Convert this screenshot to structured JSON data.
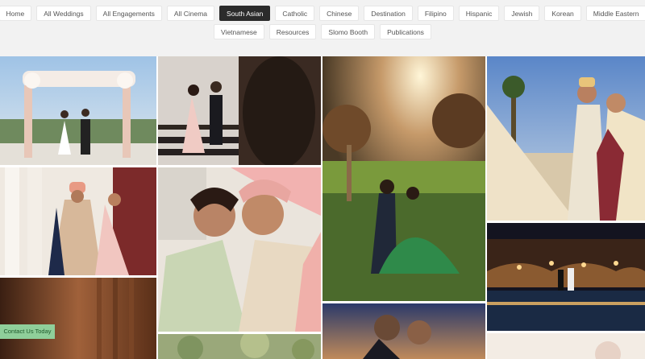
{
  "filters": {
    "row1": [
      {
        "label": "Home",
        "active": false
      },
      {
        "label": "All Weddings",
        "active": false
      },
      {
        "label": "All Engagements",
        "active": false
      },
      {
        "label": "All Cinema",
        "active": false
      },
      {
        "label": "South Asian",
        "active": true
      },
      {
        "label": "Catholic",
        "active": false
      },
      {
        "label": "Chinese",
        "active": false
      },
      {
        "label": "Destination",
        "active": false
      },
      {
        "label": "Filipino",
        "active": false
      },
      {
        "label": "Hispanic",
        "active": false
      },
      {
        "label": "Jewish",
        "active": false
      },
      {
        "label": "Korean",
        "active": false
      },
      {
        "label": "Middle Eastern",
        "active": false
      }
    ],
    "row2": [
      {
        "label": "Vietnamese",
        "active": false
      },
      {
        "label": "Resources",
        "active": false
      },
      {
        "label": "Slomo Booth",
        "active": false
      },
      {
        "label": "Publications",
        "active": false
      }
    ]
  },
  "contact": {
    "label": "Contact Us Today"
  }
}
